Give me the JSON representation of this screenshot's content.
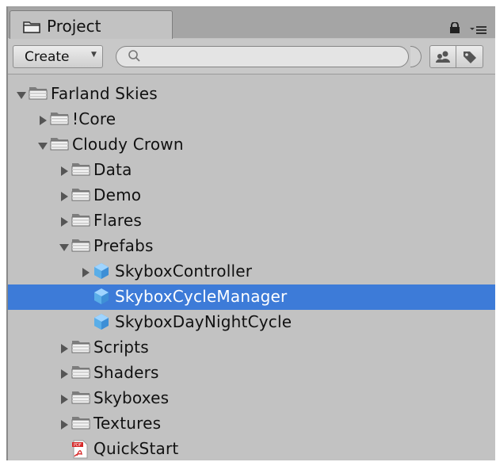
{
  "panel": {
    "tab_label": "Project",
    "tab_icon": "folder-icon",
    "header_icons": [
      "lock-icon",
      "menu-icon"
    ]
  },
  "toolbar": {
    "create_label": "Create",
    "search_placeholder": "",
    "search_value": "",
    "filter_buttons": [
      "filter-by-type-icon",
      "filter-by-label-icon"
    ]
  },
  "tree": {
    "selected": "SkyboxCycleManager",
    "items": [
      {
        "label": "Farland Skies",
        "icon": "folder-icon",
        "expanded": true
      },
      {
        "label": "!Core",
        "icon": "folder-icon",
        "expanded": false
      },
      {
        "label": "Cloudy Crown",
        "icon": "folder-icon",
        "expanded": true
      },
      {
        "label": "Data",
        "icon": "folder-icon",
        "expanded": false
      },
      {
        "label": "Demo",
        "icon": "folder-icon",
        "expanded": false
      },
      {
        "label": "Flares",
        "icon": "folder-icon",
        "expanded": false
      },
      {
        "label": "Prefabs",
        "icon": "folder-icon",
        "expanded": true
      },
      {
        "label": "SkyboxController",
        "icon": "prefab-icon",
        "expanded": false
      },
      {
        "label": "SkyboxCycleManager",
        "icon": "prefab-icon"
      },
      {
        "label": "SkyboxDayNightCycle",
        "icon": "prefab-icon"
      },
      {
        "label": "Scripts",
        "icon": "folder-icon",
        "expanded": false
      },
      {
        "label": "Shaders",
        "icon": "folder-icon",
        "expanded": false
      },
      {
        "label": "Skyboxes",
        "icon": "folder-icon",
        "expanded": false
      },
      {
        "label": "Textures",
        "icon": "folder-icon",
        "expanded": false
      },
      {
        "label": "QuickStart",
        "icon": "pdf-icon"
      }
    ]
  },
  "colors": {
    "panel_bg": "#c2c2c2",
    "selection": "#3d7bd8",
    "prefab_blue": "#5aaee8"
  }
}
